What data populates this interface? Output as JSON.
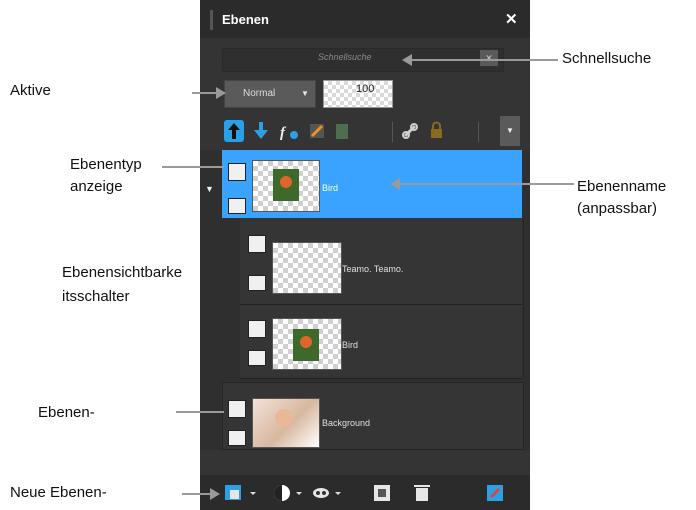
{
  "panel": {
    "title": "Ebenen",
    "search_placeholder": "Schnellsuche",
    "blend_mode": "Normal",
    "opacity": "100"
  },
  "layers": [
    {
      "name": "Bird",
      "selected": true
    },
    {
      "name": "Teamo. Teamo.",
      "selected": false
    },
    {
      "name": "Bird",
      "selected": false
    },
    {
      "name": "Background",
      "selected": false
    }
  ],
  "annotations": {
    "schnellsuche": "Schnellsuche",
    "aktive": "Aktive",
    "ebenentyp_line1": "Ebenentyp",
    "ebenentyp_line2": "anzeige",
    "ebenenname_line1": "Ebenenname",
    "ebenenname_line2": "(anpassbar)",
    "sichtbarkeit_line1": "Ebenensichtbarke",
    "sichtbarkeit_line2": "itsschalter",
    "ebenen": "Ebenen-",
    "neue_ebenen": "Neue Ebenen-"
  },
  "colors": {
    "panel_bg": "#343434",
    "selected_layer": "#3aa2ff",
    "toolbar_accent": "#2aa1e6"
  },
  "icons": [
    "close-icon",
    "clear-search-icon",
    "move-up-icon",
    "move-down-icon",
    "fx-icon",
    "mask-icon",
    "merge-icon",
    "link-icon",
    "lock-icon",
    "new-layer-icon",
    "adjustment-icon",
    "mask-layer-icon",
    "group-icon",
    "delete-icon",
    "properties-icon"
  ]
}
